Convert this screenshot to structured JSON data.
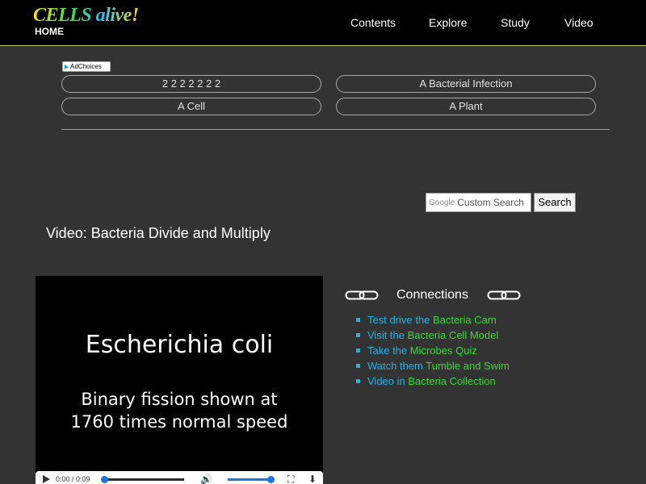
{
  "header": {
    "logo_text": "CELLS alive!",
    "home_label": "HOME",
    "nav": [
      "Contents",
      "Explore",
      "Study",
      "Video"
    ]
  },
  "ads": {
    "adchoices_label": "AdChoices",
    "buttons": [
      "2 2 2 2 2 2 2",
      "A Bacterial Infection",
      "A Cell",
      "A Plant"
    ]
  },
  "search": {
    "brand": "Google",
    "placeholder": "Custom Search",
    "button_label": "Search"
  },
  "page": {
    "title": "Video: Bacteria Divide and Multiply"
  },
  "video": {
    "line1": "Escherichia coli",
    "line2": "Binary fission shown at",
    "line3": "1760 times normal speed",
    "time": "0:00 / 0:09",
    "progress": 0,
    "volume": 1.0
  },
  "connections": {
    "title": "Connections",
    "items": [
      {
        "pre": "Test drive the ",
        "link": "Bacteria Cam"
      },
      {
        "pre": "Visit the ",
        "link": "Bacteria Cell Model"
      },
      {
        "pre": "Take the ",
        "link": "Microbes Quiz"
      },
      {
        "pre": "Watch them ",
        "link": "Tumble and Swim"
      },
      {
        "pre": "Video in ",
        "link": "Bacteria Collection"
      }
    ]
  },
  "colors": {
    "background": "#333333",
    "header_bg": "#000000",
    "link_cyan": "#1fb5e8",
    "link_green": "#33dd33",
    "media_accent": "#1a73e8"
  },
  "icons": [
    "adchoices-icon",
    "chain-link-icon",
    "play-icon",
    "volume-icon",
    "fullscreen-icon",
    "download-icon"
  ]
}
